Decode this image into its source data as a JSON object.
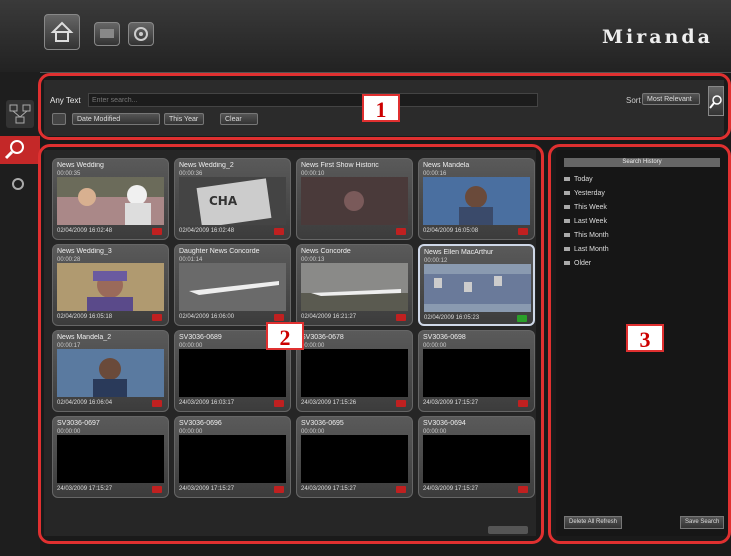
{
  "brand": "Miranda",
  "callouts": [
    "1",
    "2",
    "3"
  ],
  "search": {
    "any_text_label": "Any Text",
    "placeholder": "Enter search...",
    "sort_label": "Sort",
    "sort_value": "Most Relevant",
    "date_field": "Date Modified",
    "date_range": "This Year",
    "clear_label": "Clear"
  },
  "tiles": [
    {
      "title": "News Wedding",
      "sub": "00:00:35",
      "date": "02/04/2009 16:02:48",
      "thumb": "wedding"
    },
    {
      "title": "News Wedding_2",
      "sub": "00:00:36",
      "date": "02/04/2009 16:02:48",
      "thumb": "sign"
    },
    {
      "title": "News First Show Historic",
      "sub": "00:00:10",
      "date": "",
      "thumb": "dim"
    },
    {
      "title": "News Mandela",
      "sub": "00:00:16",
      "date": "02/04/2009 16:05:08",
      "thumb": "mandela"
    },
    {
      "title": "News Wedding_3",
      "sub": "00:00:28",
      "date": "02/04/2009 16:05:18",
      "thumb": "woman"
    },
    {
      "title": "Daughter News Concorde",
      "sub": "00:01:14",
      "date": "02/04/2009 16:06:00",
      "thumb": "plane"
    },
    {
      "title": "News Concorde",
      "sub": "00:00:13",
      "date": "02/04/2009 16:21:27",
      "thumb": "plane2"
    },
    {
      "title": "News Ellen MacArthur",
      "sub": "00:00:12",
      "date": "02/04/2009 16:05:23",
      "thumb": "crowd",
      "selected": true
    },
    {
      "title": "News Mandela_2",
      "sub": "00:00:17",
      "date": "02/04/2009 16:06:04",
      "thumb": "mandela2"
    },
    {
      "title": "SV3036-0689",
      "sub": "00:00:00",
      "date": "24/03/2009 16:03:17",
      "thumb": "black"
    },
    {
      "title": "SV3036-0678",
      "sub": "00:00:00",
      "date": "24/03/2009 17:15:26",
      "thumb": "black"
    },
    {
      "title": "SV3036-0698",
      "sub": "00:00:00",
      "date": "24/03/2009 17:15:27",
      "thumb": "black"
    },
    {
      "title": "SV3036-0697",
      "sub": "00:00:00",
      "date": "24/03/2009 17:15:27",
      "thumb": "black"
    },
    {
      "title": "SV3036-0696",
      "sub": "00:00:00",
      "date": "24/03/2009 17:15:27",
      "thumb": "black"
    },
    {
      "title": "SV3036-0695",
      "sub": "00:00:00",
      "date": "24/03/2009 17:15:27",
      "thumb": "black"
    },
    {
      "title": "SV3036-0694",
      "sub": "00:00:00",
      "date": "24/03/2009 17:15:27",
      "thumb": "black"
    }
  ],
  "history": {
    "header": "Search History",
    "items": [
      "Today",
      "Yesterday",
      "This Week",
      "Last Week",
      "This Month",
      "Last Month",
      "Older"
    ],
    "delete_label": "Delete All Refresh",
    "save_label": "Save Search"
  },
  "colors": {
    "callout": "#e03030",
    "accent_red": "#c02020"
  }
}
